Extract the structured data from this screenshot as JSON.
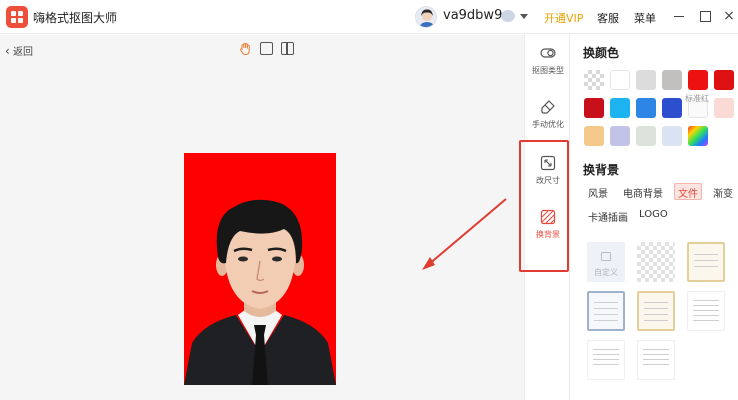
{
  "app": {
    "title": "嗨格式抠图大师"
  },
  "header": {
    "username": "va9dbw9",
    "vip_label": "开通VIP",
    "service_label": "客服",
    "menu_label": "菜单",
    "minimize_glyph": "—",
    "maximize_glyph": "□",
    "close_glyph": "×",
    "icons": [
      "app-logo-icon",
      "avatar",
      "member-badge-icon",
      "chevron-down-icon"
    ]
  },
  "canvas": {
    "back_label": "返回",
    "back_glyph": "‹",
    "toolbar_icons": [
      "hand-icon",
      "fit-screen-icon",
      "compare-icon"
    ],
    "background_color": "#ff0000"
  },
  "tools": [
    {
      "label": "抠图类型",
      "icon": "toggle-icon"
    },
    {
      "label": "手动优化",
      "icon": "eraser-icon"
    },
    {
      "label": "改尺寸",
      "icon": "resize-icon"
    },
    {
      "label": "换背景",
      "icon": "background-icon",
      "active": true
    }
  ],
  "color_section": {
    "title": "换颜色",
    "standard_label": "标准红",
    "colors": [
      "transparent",
      "#ffffff",
      "#dcdcdc",
      "#c2bfbf",
      "#ee1111",
      "#dd1111",
      "#c8101a",
      "#1cb3f0",
      "#2d86e6",
      "#2d4fcf",
      "#fafafa",
      "#fadad5",
      "#f5c98a",
      "#c3c3e8",
      "#dde3dc",
      "#d8e4f4",
      "rainbow"
    ]
  },
  "background_section": {
    "title": "换背景",
    "categories": [
      "风景",
      "电商背景",
      "文件",
      "渐变",
      "卡通插画",
      "LOGO"
    ],
    "active_category": "文件",
    "custom_label": "自定义"
  },
  "accent_color": "#e23b31"
}
